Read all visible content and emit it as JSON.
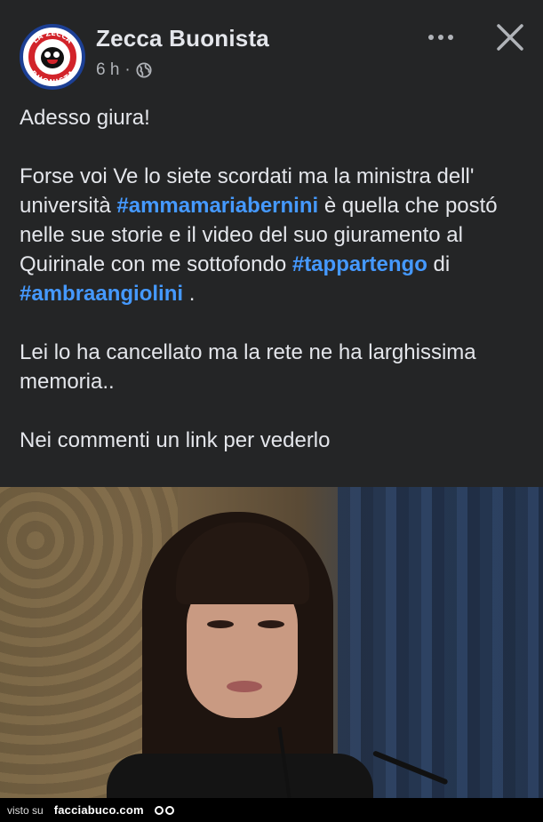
{
  "post": {
    "page_name": "Zecca Buonista",
    "time": "6 h",
    "separator": "·",
    "paragraphs": {
      "p1": "Adesso giura!",
      "p2_a": "Forse voi Ve lo siete scordati ma la ministra dell' università ",
      "p2_tag1": "#ammamariabernini",
      "p2_b": " è quella che postó nelle sue storie e il video del suo giuramento al Quirinale con me sottofondo ",
      "p2_tag2": "#tappartengo",
      "p2_c": " di ",
      "p2_tag3": "#ambraangiolini",
      "p2_d": " .",
      "p3": "Lei lo ha cancellato ma la rete ne ha larghissima memoria..",
      "p4": "Nei commenti un link per vederlo"
    }
  },
  "avatar": {
    "logo_text_top": "LA ZECCA",
    "logo_text_bottom": "BUONISTA"
  },
  "footer": {
    "visto_su": "visto su",
    "brand": "facciabuco.com"
  },
  "colors": {
    "background": "#242526",
    "text": "#e4e6eb",
    "hashtag": "#4599ff",
    "secondary": "#b0b3b8"
  },
  "icons": {
    "privacy": "globe-icon",
    "more": "more-options-icon",
    "close": "close-icon"
  }
}
